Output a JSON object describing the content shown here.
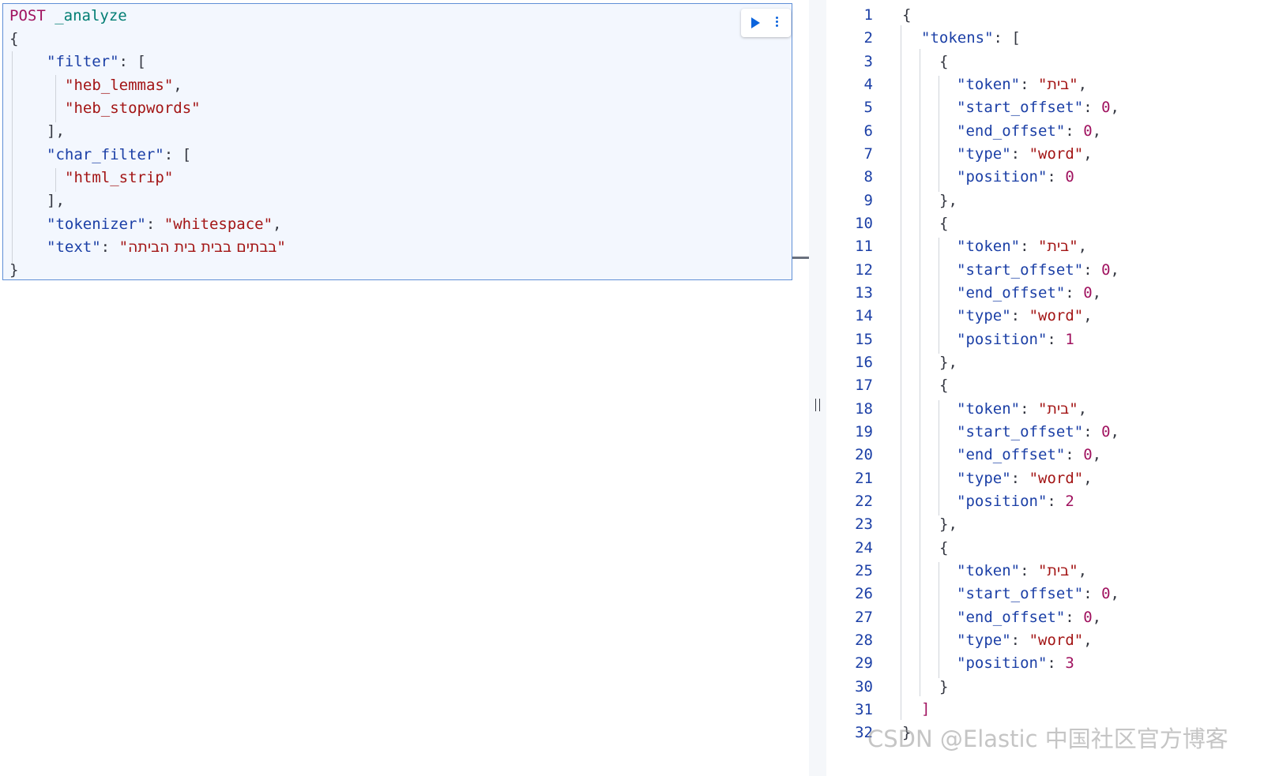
{
  "request": {
    "method": "POST",
    "path": "_analyze",
    "filter_key": "filter",
    "filter_values": [
      "heb_lemmas",
      "heb_stopwords"
    ],
    "char_filter_key": "char_filter",
    "char_filter_values": [
      "html_strip"
    ],
    "tokenizer_key": "tokenizer",
    "tokenizer_value": "whitespace",
    "text_key": "text",
    "text_value": "בבתים בבית בית הביתה"
  },
  "response": {
    "line_numbers": [
      "1",
      "2",
      "3",
      "4",
      "5",
      "6",
      "7",
      "8",
      "9",
      "10",
      "11",
      "12",
      "13",
      "14",
      "15",
      "16",
      "17",
      "18",
      "19",
      "20",
      "21",
      "22",
      "23",
      "24",
      "25",
      "26",
      "27",
      "28",
      "29",
      "30",
      "31",
      "32"
    ],
    "tokens_key": "tokens",
    "keys": {
      "token": "token",
      "start_offset": "start_offset",
      "end_offset": "end_offset",
      "type": "type",
      "position": "position"
    },
    "tokens": [
      {
        "token": "בית",
        "start_offset": "0",
        "end_offset": "0",
        "type": "word",
        "position": "0"
      },
      {
        "token": "בית",
        "start_offset": "0",
        "end_offset": "0",
        "type": "word",
        "position": "1"
      },
      {
        "token": "בית",
        "start_offset": "0",
        "end_offset": "0",
        "type": "word",
        "position": "2"
      },
      {
        "token": "בית",
        "start_offset": "0",
        "end_offset": "0",
        "type": "word",
        "position": "3"
      }
    ]
  },
  "watermark": "CSDN @Elastic 中国社区官方博客",
  "icons": {
    "run": "play-icon",
    "more": "more-vertical-icon"
  }
}
